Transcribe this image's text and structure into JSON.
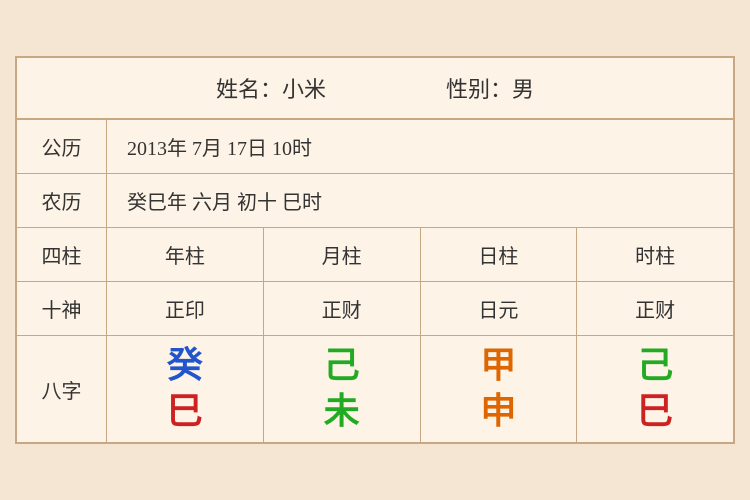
{
  "header": {
    "name_label": "姓名：小米",
    "gender_label": "性别：男"
  },
  "solar": {
    "label": "公历",
    "value": "2013年 7月 17日 10时"
  },
  "lunar": {
    "label": "农历",
    "value": "癸巳年 六月 初十 巳时"
  },
  "table": {
    "headers": {
      "col_label": "四柱",
      "year": "年柱",
      "month": "月柱",
      "day": "日柱",
      "hour": "时柱"
    },
    "shishen": {
      "label": "十神",
      "year": "正印",
      "month": "正财",
      "day": "日元",
      "hour": "正财"
    },
    "bazhi": {
      "label": "八字",
      "year_top": "癸",
      "year_bottom": "巳",
      "month_top": "己",
      "month_bottom": "未",
      "day_top": "甲",
      "day_bottom": "申",
      "hour_top": "己",
      "hour_bottom": "巳"
    }
  },
  "colors": {
    "year_top": "blue",
    "year_bottom": "red",
    "month_top": "green",
    "month_bottom": "green",
    "day_top": "orange",
    "day_bottom": "orange",
    "hour_top": "green",
    "hour_bottom": "red"
  }
}
